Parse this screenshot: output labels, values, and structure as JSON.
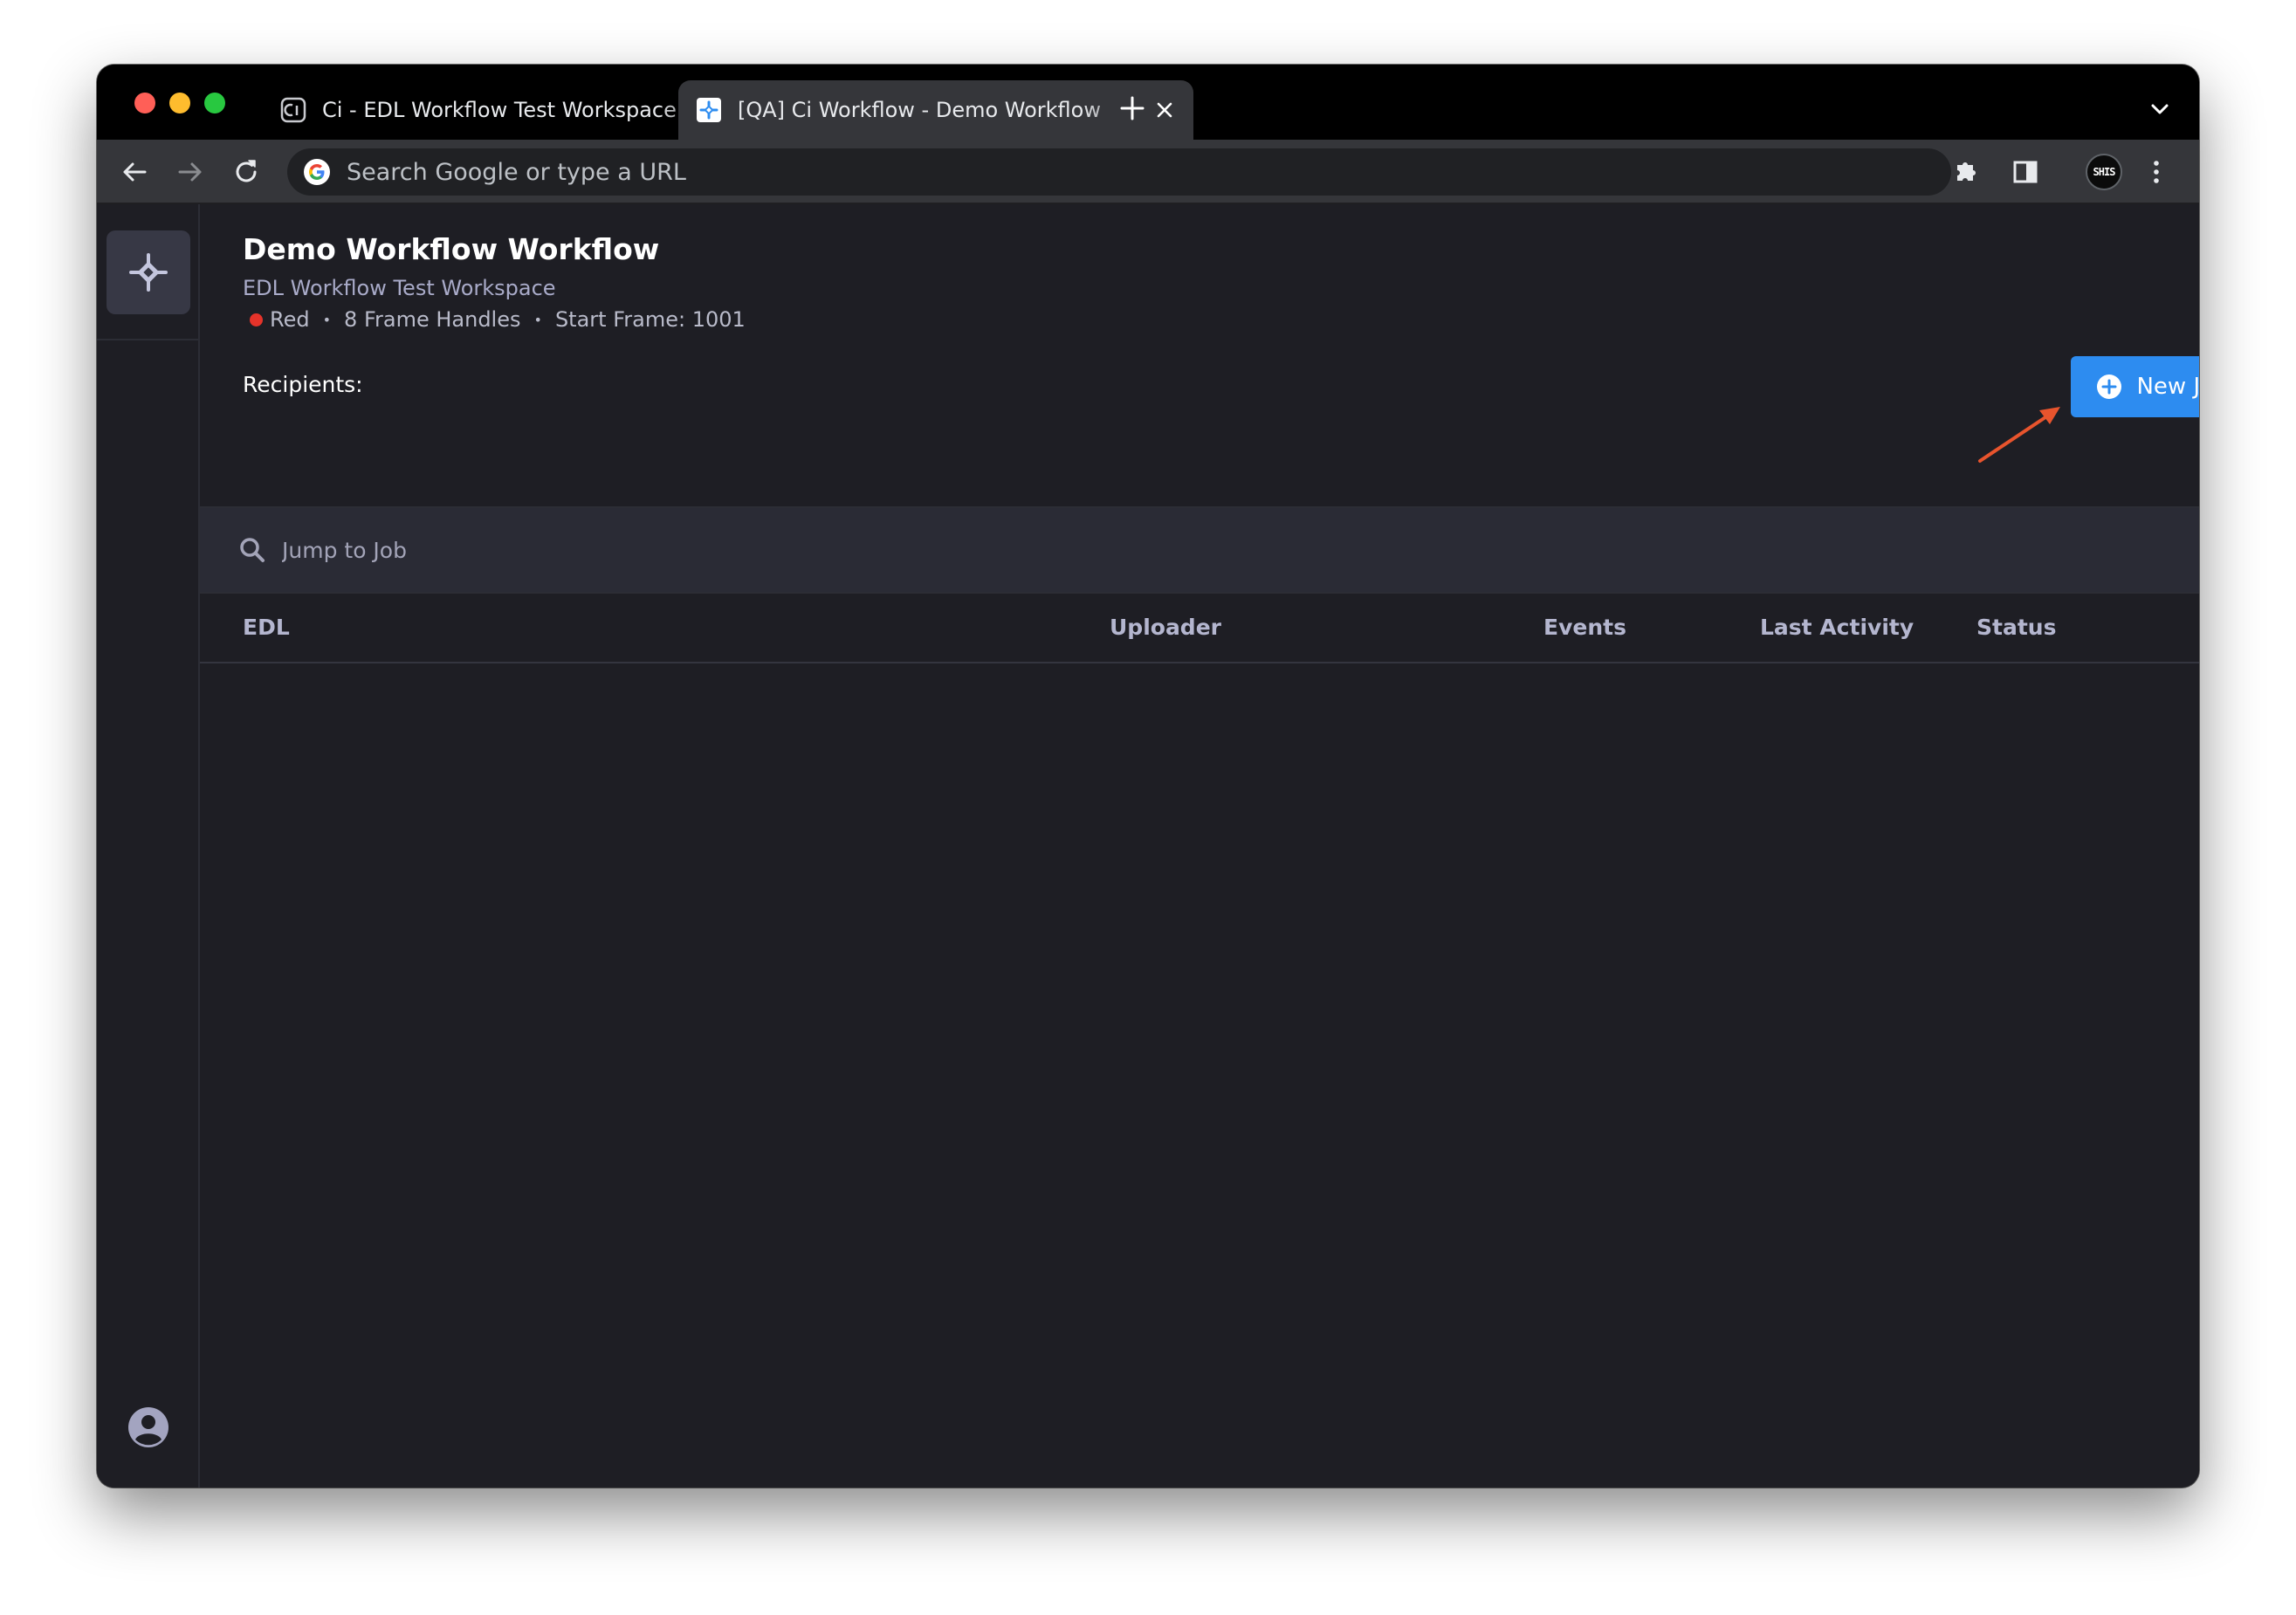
{
  "browser": {
    "tabs": [
      {
        "title": "Ci - EDL Workflow Test Workspace",
        "active": false,
        "favicon": "ci-logo-icon"
      },
      {
        "title": "[QA] Ci Workflow - Demo Workflow",
        "active": true,
        "favicon": "ci-workflow-icon"
      }
    ],
    "omnibox": {
      "placeholder": "Search Google or type a URL",
      "value": ""
    },
    "profile_badge": "SHIS"
  },
  "workflow": {
    "title": "Demo Workflow Workflow",
    "workspace": "EDL Workflow Test Workspace",
    "meta": {
      "color_label": "Red",
      "color": "#e5332a",
      "frame_handles": "8 Frame Handles",
      "start_frame": "Start Frame: 1001",
      "separator": "•"
    },
    "recipients_label": "Recipients:"
  },
  "actions": {
    "new_job_label": "New Job",
    "new_job_color": "#2d8cf0"
  },
  "search": {
    "placeholder": "Jump to Job",
    "value": ""
  },
  "jobs_table": {
    "columns": [
      "EDL",
      "Uploader",
      "Events",
      "Last Activity",
      "Status"
    ],
    "rows": []
  },
  "colors": {
    "app_background": "#1e1e24",
    "sidebar_logo_background": "#373845",
    "annotation_arrow": "#e8542d"
  }
}
